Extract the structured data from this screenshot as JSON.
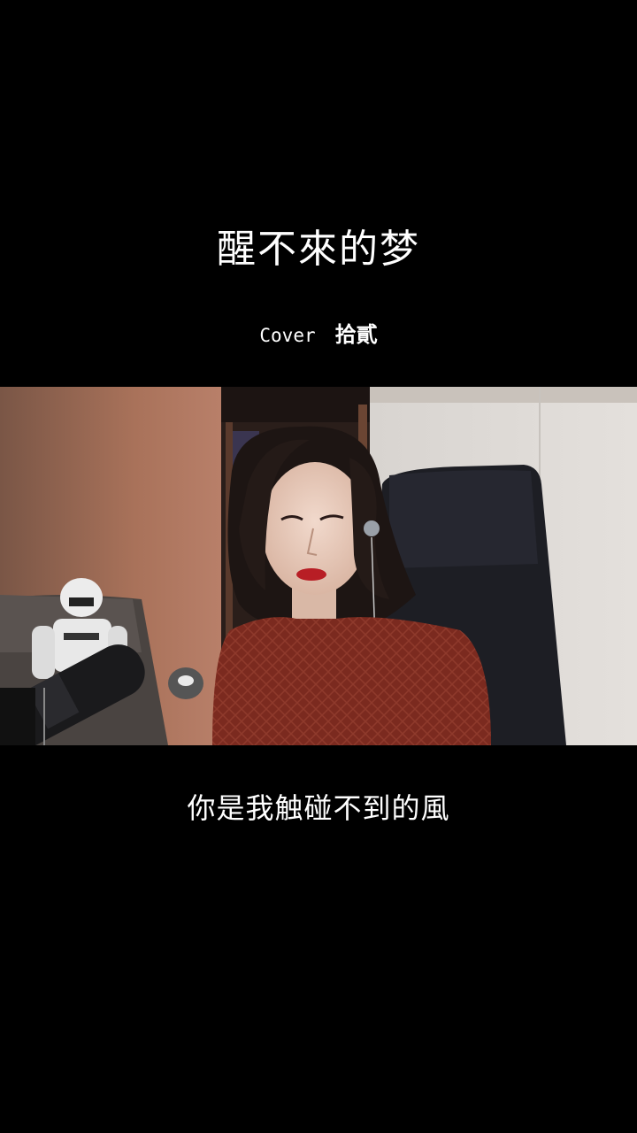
{
  "song": {
    "title": "醒不來的梦",
    "cover_label": "Cover",
    "artist": "拾貳"
  },
  "video": {
    "description_icon": "video-frame"
  },
  "lyrics": {
    "current_line": "你是我触碰不到的風"
  },
  "colors": {
    "background": "#000000",
    "text": "#ffffff"
  }
}
